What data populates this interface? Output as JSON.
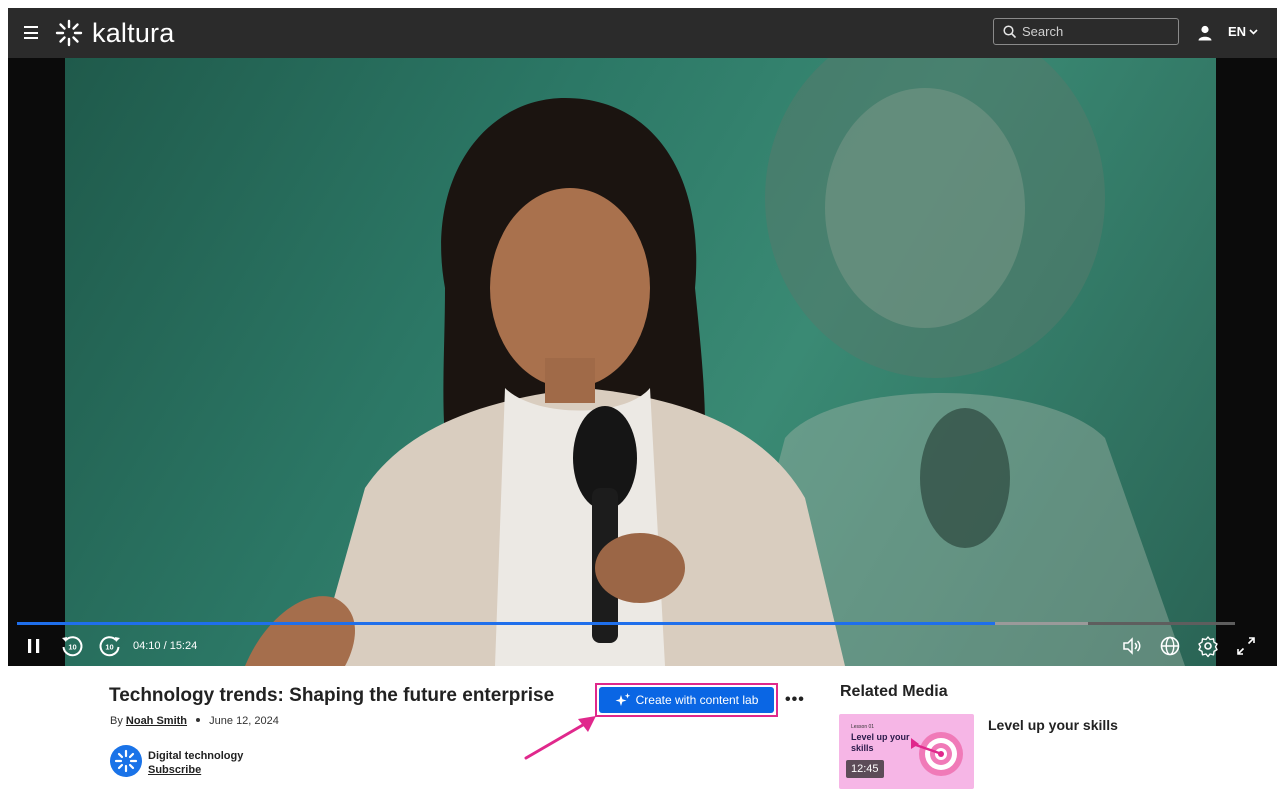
{
  "header": {
    "brand": "kaltura",
    "search_placeholder": "Search",
    "language": "EN"
  },
  "player": {
    "time": "04:10 / 15:24",
    "played_fraction": 0.803,
    "buffered_fraction": 0.879
  },
  "media": {
    "title": "Technology trends: Shaping the future enterprise",
    "by_prefix": "By",
    "author": "Noah Smith",
    "date": "June 12, 2024",
    "channel_name": "Digital technology",
    "subscribe_label": "Subscribe"
  },
  "actions": {
    "content_lab_label": "Create with content lab",
    "more_label": "•••"
  },
  "related": {
    "heading": "Related Media",
    "items": [
      {
        "title": "Level up your skills",
        "thumb_lesson": "Lesson 01",
        "thumb_text": "Level up your skills",
        "duration": "12:45"
      }
    ]
  },
  "colors": {
    "accent": "#0a66e4",
    "highlight": "#e0288c",
    "topbar": "#2b2b2b"
  }
}
